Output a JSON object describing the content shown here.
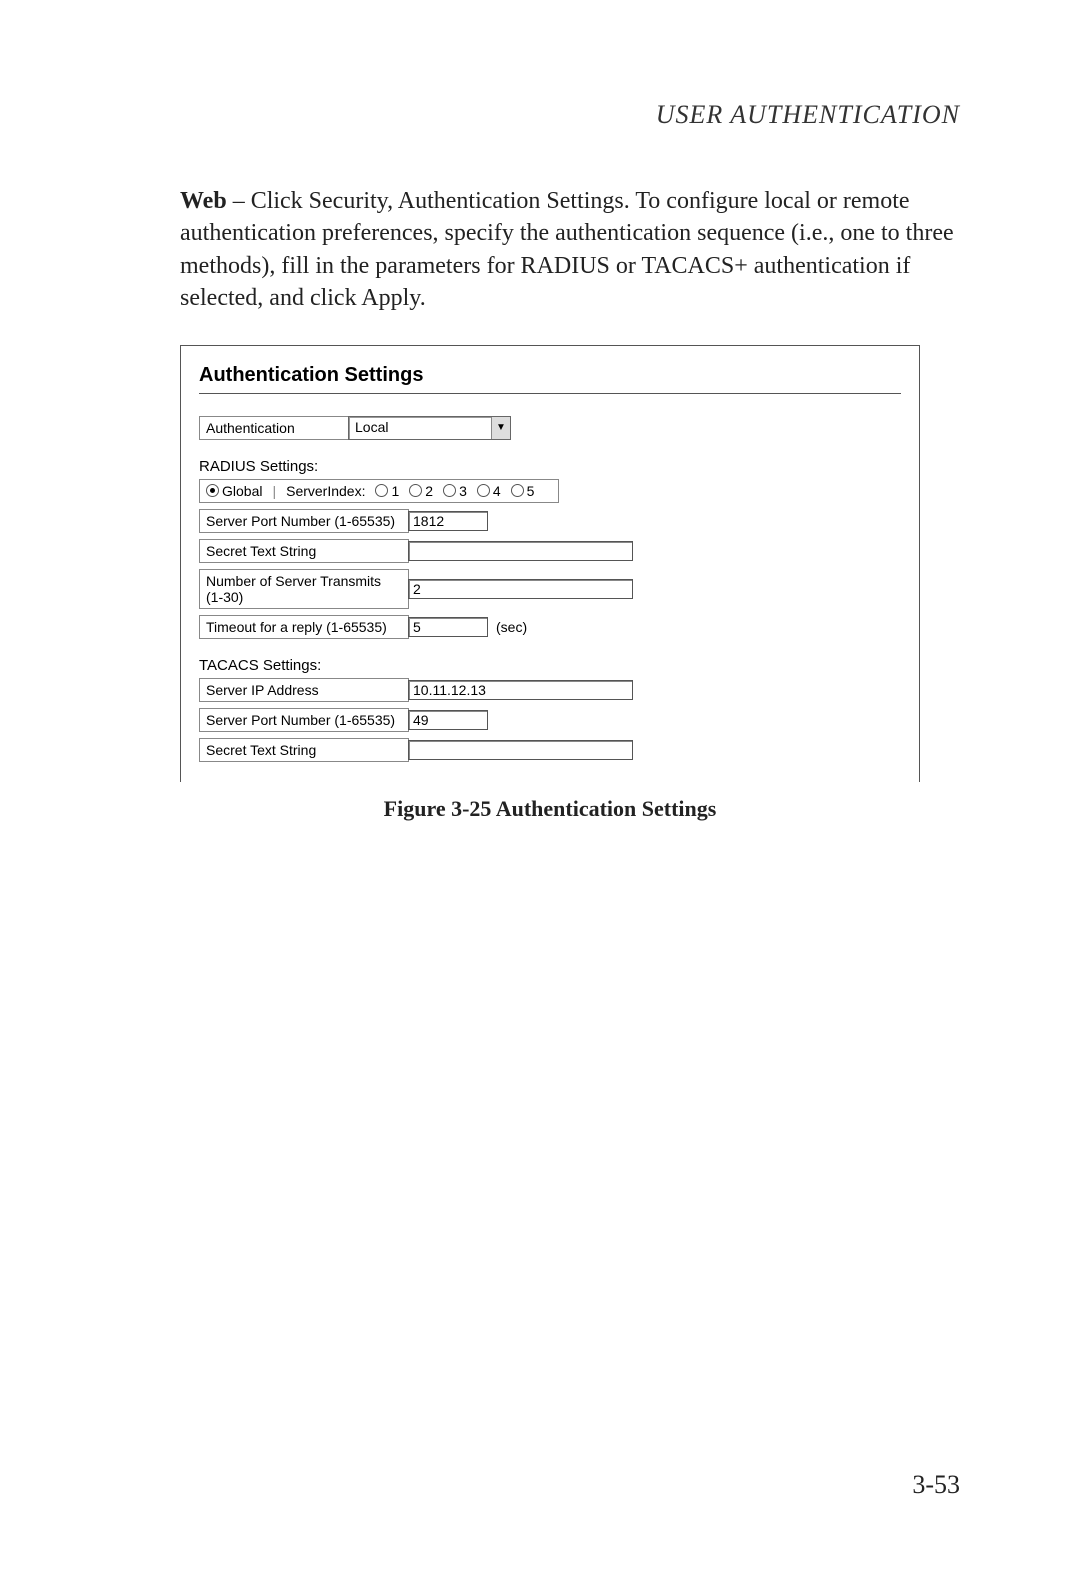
{
  "header": {
    "running": "USER AUTHENTICATION"
  },
  "para": {
    "lead": "Web",
    "rest": " – Click Security, Authentication Settings. To configure local or remote authentication preferences, specify the authentication sequence (i.e., one to three methods), fill in the parameters for RADIUS or TACACS+ authentication if selected, and click Apply."
  },
  "panel": {
    "title": "Authentication Settings",
    "auth_label": "Authentication",
    "auth_value": "Local",
    "radius_heading": "RADIUS Settings:",
    "radio": {
      "global": "Global",
      "server_index_label": "ServerIndex:",
      "options": [
        "1",
        "2",
        "3",
        "4",
        "5"
      ],
      "selected": "Global"
    },
    "radius_rows": {
      "port_label": "Server Port Number (1-65535)",
      "port_value": "1812",
      "secret_label": "Secret Text String",
      "secret_value": "",
      "transmits_label": "Number of Server Transmits (1-30)",
      "transmits_value": "2",
      "timeout_label": "Timeout for a reply (1-65535)",
      "timeout_value": "5",
      "timeout_unit": "(sec)"
    },
    "tacacs_heading": "TACACS Settings:",
    "tacacs_rows": {
      "ip_label": "Server IP Address",
      "ip_value": "10.11.12.13",
      "port_label": "Server Port Number (1-65535)",
      "port_value": "49",
      "secret_label": "Secret Text String",
      "secret_value": ""
    }
  },
  "caption": "Figure 3-25  Authentication Settings",
  "page_number": "3-53"
}
